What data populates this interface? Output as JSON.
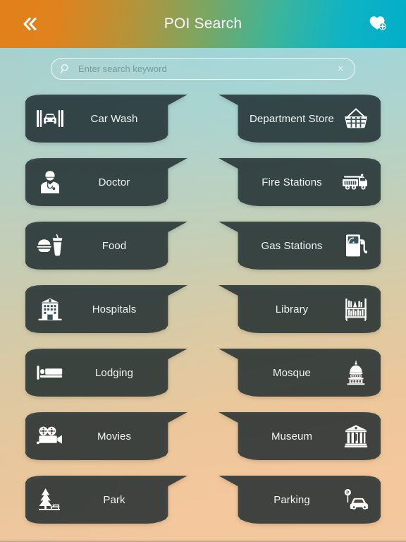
{
  "header": {
    "title": "POI Search",
    "back_icon": "double-chevron-left-icon",
    "favorite_icon": "heart-plus-icon",
    "gradient_start": "#e2801c",
    "gradient_end": "#02aec9"
  },
  "search": {
    "placeholder": "Enter search keyword",
    "value": "",
    "search_icon": "search-icon",
    "clear_label": "×"
  },
  "background": {
    "top_color": "#8ed5e0",
    "bottom_left_color": "#d3c5a4",
    "bottom_right_color": "#f2c89e"
  },
  "card_style": {
    "fill": "rgba(26,40,44,0.80)",
    "label_color": "#f2f4f4"
  },
  "categories": [
    {
      "label": "Car Wash",
      "icon": "car-wash-icon",
      "side": "left"
    },
    {
      "label": "Department Store",
      "icon": "shopping-basket-icon",
      "side": "right"
    },
    {
      "label": "Doctor",
      "icon": "doctor-icon",
      "side": "left"
    },
    {
      "label": "Fire Stations",
      "icon": "fire-truck-icon",
      "side": "right"
    },
    {
      "label": "Food",
      "icon": "burger-drink-icon",
      "side": "left"
    },
    {
      "label": "Gas Stations",
      "icon": "fuel-pump-icon",
      "side": "right"
    },
    {
      "label": "Hospitals",
      "icon": "hospital-icon",
      "side": "left"
    },
    {
      "label": "Library",
      "icon": "bookshelf-icon",
      "side": "right"
    },
    {
      "label": "Lodging",
      "icon": "bed-icon",
      "side": "left"
    },
    {
      "label": "Mosque",
      "icon": "domed-building-icon",
      "side": "right"
    },
    {
      "label": "Movies",
      "icon": "film-projector-icon",
      "side": "left"
    },
    {
      "label": "Museum",
      "icon": "museum-icon",
      "side": "right"
    },
    {
      "label": "Park",
      "icon": "park-tree-icon",
      "side": "left"
    },
    {
      "label": "Parking",
      "icon": "parking-car-icon",
      "side": "right"
    }
  ]
}
